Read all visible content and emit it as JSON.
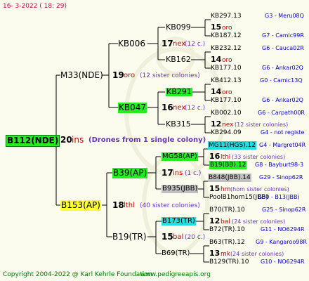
{
  "header": {
    "date": "16-  3-2022 ( 18: 29)"
  },
  "footer": {
    "copyright": "Copyright 2004-2022 @ Karl Kehrle Foundation",
    "site": "www.pedigreeapis.org"
  },
  "root": {
    "id": "B112(NDE)",
    "num": "20",
    "code": "ins",
    "note": "(Drones from 1 single colony)"
  },
  "gen1": {
    "top": {
      "id": "M33(NDE)",
      "num": "19",
      "code": "oro",
      "note": "(12 sister colonies)"
    },
    "bottom": {
      "id": "B153(AP)",
      "num": "18",
      "code": "lthl",
      "note": "(40 sister colonies)"
    }
  },
  "gen2": {
    "kb006": {
      "id": "KB006",
      "num": "17",
      "code": "nex",
      "note": "(12 c.)"
    },
    "kb047": {
      "id": "KB047",
      "num": "16",
      "code": "nex",
      "note": "(12 c.)"
    },
    "b39": {
      "id": "B39(AP)",
      "num": "17",
      "code": "ins",
      "note": "(1 c.)"
    },
    "b19": {
      "id": "B19(TR)",
      "num": "15",
      "code": "bal",
      "note": "(20 c.)"
    }
  },
  "gen3": {
    "kb099": {
      "id": "KB099",
      "num": "15",
      "code": "oro"
    },
    "kb162": {
      "id": "KB162",
      "num": "14",
      "code": "oro"
    },
    "kb291": {
      "id": "KB291",
      "num": "14",
      "code": "oro"
    },
    "kb315": {
      "id": "KB315",
      "num": "12",
      "code": "nex",
      "note": "(12 sister colonies)"
    },
    "mg58": {
      "id": "MG58(AP)",
      "num": "16",
      "code": "lthl",
      "note": "(33 sister colonies)"
    },
    "b935": {
      "id": "B935(JBB)",
      "num": "15",
      "code": "hm",
      "note": "(hom sister colonies)"
    },
    "b173": {
      "id": "B173(TR)",
      "num": "12",
      "code": "bal",
      "note": "(24 sister colonies)"
    },
    "b69": {
      "id": "B69(TR)",
      "num": "13",
      "code": "mk",
      "note": "(24 sister colonies)"
    }
  },
  "gen4": [
    {
      "left": "KB297.13",
      "right": "G3 - Meru08Q"
    },
    {
      "left": "KB187.12",
      "right": "G7 - Camic99R"
    },
    {
      "left": "KB232.12",
      "right": "G6 - Cauca02R"
    },
    {
      "left": "KB177.10",
      "right": "G6 - Ankar02Q"
    },
    {
      "left": "KB412.13",
      "right": "G0 - Camic13Q"
    },
    {
      "left": "KB177.10",
      "right": "G6 - Ankar02Q"
    },
    {
      "left": "KB002.10",
      "right": "G6 - Carpath00R"
    },
    {
      "left": "KB294.09",
      "right": "G4 - not registe"
    },
    {
      "left": "MG11(HGS).12",
      "right": "G4 - Margret04R"
    },
    {
      "left": "B19(BB).12",
      "right": "G8 - Bayburt98-3"
    },
    {
      "left": "B848(JBB).14",
      "right": "G29 - Sinop62R"
    },
    {
      "left": "PoolB1hom15(JBB)",
      "right": "G30 - B13(JBB)"
    },
    {
      "left": "B70(TR).10",
      "right": "G25 - Sinop62R"
    },
    {
      "left": "B72(TR).10",
      "right": "G11 - NO6294R"
    },
    {
      "left": "B63(TR).12",
      "right": "G9 - Kangaroo98R"
    },
    {
      "left": "B129(TR).10",
      "right": "G10 - NO6294R"
    }
  ]
}
